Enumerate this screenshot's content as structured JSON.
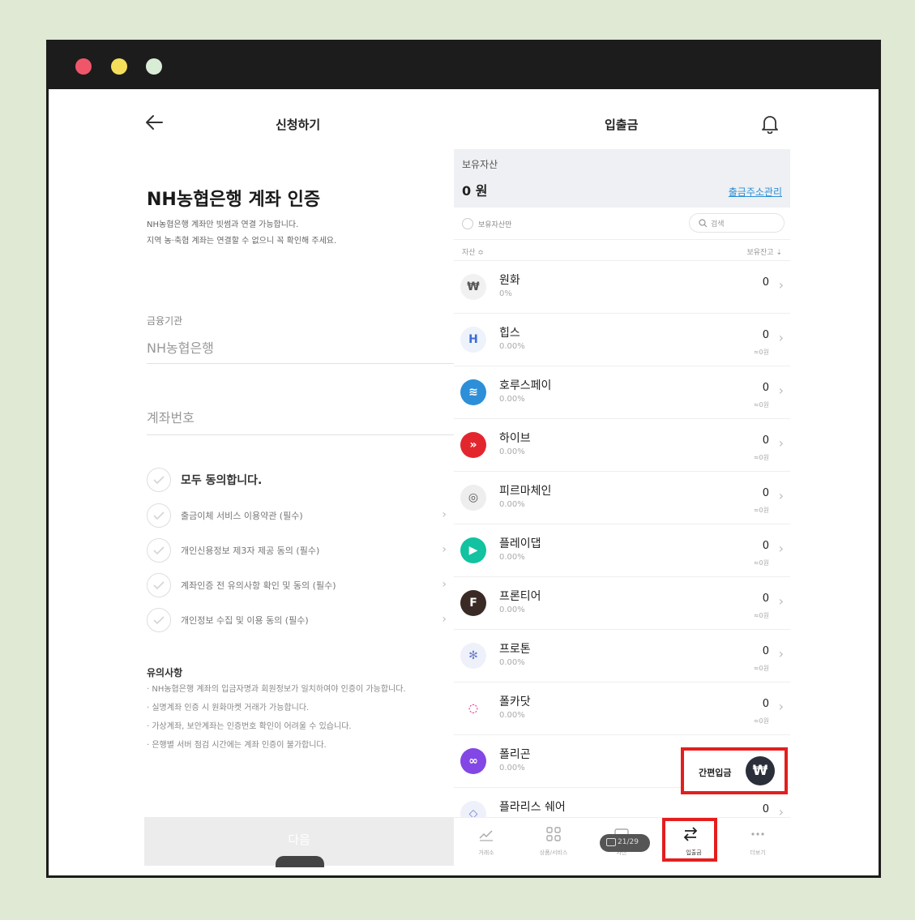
{
  "window": {
    "controls": [
      "close",
      "minimize",
      "maximize"
    ]
  },
  "left_panel": {
    "header_title": "신청하기",
    "auth_title": "NH농협은행 계좌 인증",
    "auth_desc_1": "NH농협은행 계좌만 빗썸과 연결 가능합니다.",
    "auth_desc_2": "지역 농·축협 계좌는 연결할 수 없으니 꼭 확인해 주세요.",
    "institution_label": "금융기관",
    "institution_value": "NH농협은행",
    "account_placeholder": "계좌번호",
    "agree_all": "모두 동의합니다.",
    "agreements": [
      {
        "label": "출금이체 서비스 이용약관 (필수)"
      },
      {
        "label": "개인신용정보 제3자 제공 동의 (필수)"
      },
      {
        "label": "계좌인증 전 유의사항 확인 및 동의 (필수)"
      },
      {
        "label": "개인정보 수집 및 이용 동의 (필수)"
      }
    ],
    "notice_title": "유의사항",
    "notices": [
      "· NH농협은행 계좌의 입금자명과 회원정보가 일치하여야 인증이 가능합니다.",
      "· 실명계좌 인증 시 원화마켓 거래가 가능합니다.",
      "· 가상계좌, 보안계좌는 인증번호 확인이 어려울 수 있습니다.",
      "· 은행별 서버 점검 시간에는 계좌 인증이 불가합니다."
    ],
    "next_button": "다음"
  },
  "right_panel": {
    "header_title": "입출금",
    "holdings_label": "보유자산",
    "holdings_amount": "0 원",
    "withdraw_address_link": "출금주소관리",
    "filter_label": "보유자산만",
    "search_placeholder": "검색",
    "col_asset": "자산 ≎",
    "col_balance": "보유잔고 ⇣",
    "assets": [
      {
        "name": "원화",
        "pct": "0%",
        "qty": "0",
        "krw": "",
        "symbol": "₩",
        "color": "#f1f1f1",
        "fg": "#555"
      },
      {
        "name": "힙스",
        "pct": "0.00%",
        "qty": "0",
        "krw": "≈0원",
        "symbol": "H",
        "color": "#eef2fb",
        "fg": "#3a6fd8"
      },
      {
        "name": "호루스페이",
        "pct": "0.00%",
        "qty": "0",
        "krw": "≈0원",
        "symbol": "≋",
        "color": "#2d8fd8",
        "fg": "#fff"
      },
      {
        "name": "하이브",
        "pct": "0.00%",
        "qty": "0",
        "krw": "≈0원",
        "symbol": "»",
        "color": "#e3262e",
        "fg": "#fff"
      },
      {
        "name": "피르마체인",
        "pct": "0.00%",
        "qty": "0",
        "krw": "≈0원",
        "symbol": "◎",
        "color": "#eeeeee",
        "fg": "#555"
      },
      {
        "name": "플레이댑",
        "pct": "0.00%",
        "qty": "0",
        "krw": "≈0원",
        "symbol": "▶",
        "color": "#12c2a0",
        "fg": "#fff"
      },
      {
        "name": "프론티어",
        "pct": "0.00%",
        "qty": "0",
        "krw": "≈0원",
        "symbol": "F",
        "color": "#3a2a25",
        "fg": "#fff"
      },
      {
        "name": "프로톤",
        "pct": "0.00%",
        "qty": "0",
        "krw": "≈0원",
        "symbol": "✻",
        "color": "#eef1fa",
        "fg": "#6a7fd0"
      },
      {
        "name": "폴카닷",
        "pct": "0.00%",
        "qty": "0",
        "krw": "≈0원",
        "symbol": "◌",
        "color": "#ffffff",
        "fg": "#e6007a"
      },
      {
        "name": "폴리곤",
        "pct": "0.00%",
        "qty": "",
        "krw": "",
        "symbol": "∞",
        "color": "#8247e5",
        "fg": "#fff"
      },
      {
        "name": "플라리스 쉐어",
        "pct": "",
        "qty": "0",
        "krw": "",
        "symbol": "◇",
        "color": "#eef1fa",
        "fg": "#6a7fd0"
      }
    ],
    "quick_deposit_label": "간편입금",
    "quick_deposit_symbol": "₩",
    "page_counter": "21/29",
    "nav": [
      {
        "label": "거래소"
      },
      {
        "label": "상품/서비스"
      },
      {
        "label": "자산"
      },
      {
        "label": "입출금"
      },
      {
        "label": "더보기"
      }
    ]
  }
}
